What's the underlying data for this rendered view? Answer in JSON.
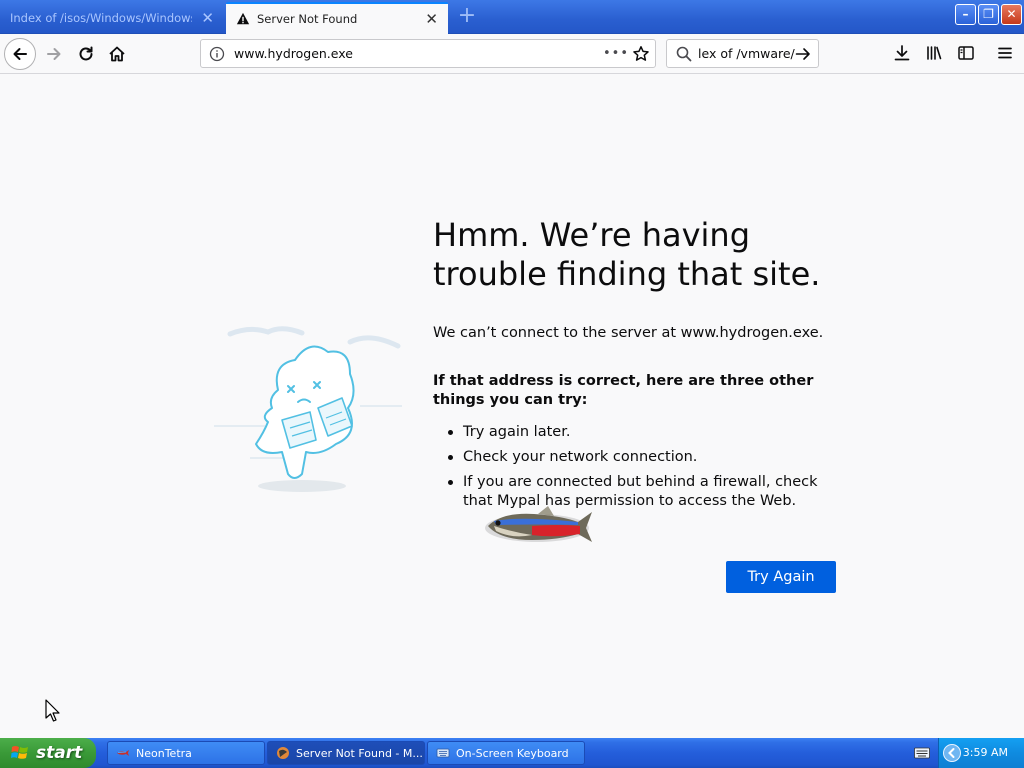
{
  "browser": {
    "tabs": [
      {
        "title": "Index of /isos/Windows/Windows_Vist",
        "active": false
      },
      {
        "title": "Server Not Found",
        "active": true
      }
    ],
    "url": "www.hydrogen.exe",
    "search_value": "lex of /vmware/",
    "icons": [
      "back-icon",
      "forward-icon",
      "reload-icon",
      "home-icon",
      "info-icon",
      "page-actions-icon",
      "bookmark-star-icon",
      "search-icon",
      "go-arrow-icon",
      "download-icon",
      "library-icon",
      "sidebar-icon",
      "menu-icon"
    ]
  },
  "error_page": {
    "title": "Hmm. We’re having trouble finding that site.",
    "description": "We can’t connect to the server at www.hydrogen.exe.",
    "suggestions_heading": "If that address is correct, here are three other things you can try:",
    "suggestions": [
      "Try again later.",
      "Check your network connection.",
      "If you are connected but behind a firewall, check that Mypal has permission to access the Web."
    ],
    "try_again_label": "Try Again"
  },
  "taskbar": {
    "start_label": "start",
    "tasks": [
      {
        "label": "NeonTetra"
      },
      {
        "label": "Server Not Found - M..."
      },
      {
        "label": "On-Screen Keyboard"
      }
    ],
    "clock": "3:59 AM"
  },
  "colors": {
    "accent": "#0060df",
    "taskbar": "#245edb",
    "start": "#3a9a38"
  }
}
